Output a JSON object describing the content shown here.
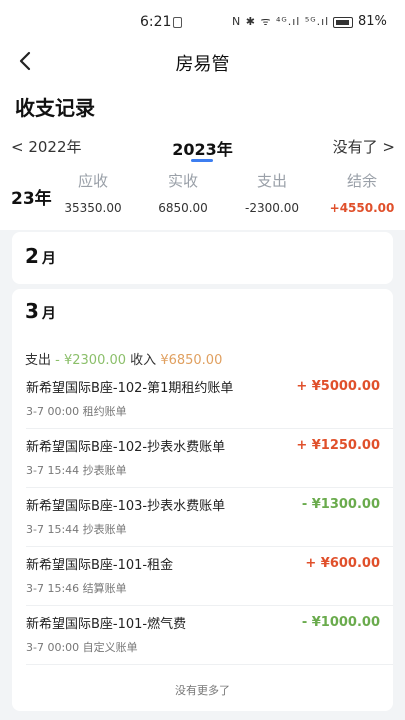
{
  "status_bar": {
    "time": "6:21",
    "icons": "N ✱ ᯤ ⁴ᴳ.ıl ⁵ᴳ.ıl",
    "battery": "81%"
  },
  "navbar": {
    "title": "房易管",
    "back_icon": "chevron-left-icon"
  },
  "header": {
    "title": "收支记录"
  },
  "year_tabs": {
    "prev": "< 2022年",
    "current": "2023年",
    "next": "没有了 >"
  },
  "summary": {
    "year_label": "23年",
    "columns": [
      {
        "label": "应收",
        "value": "35350.00"
      },
      {
        "label": "实收",
        "value": "6850.00"
      },
      {
        "label": "支出",
        "value": "-2300.00"
      },
      {
        "label": "结余",
        "value": "+4550.00"
      }
    ]
  },
  "months": [
    {
      "month": "2",
      "unit": "月"
    },
    {
      "month": "3",
      "unit": "月",
      "stats": {
        "expense_label": "支出",
        "expense": "- ¥2300.00",
        "income_label": "收入",
        "income": "¥6850.00"
      },
      "records": [
        {
          "title": "新希望国际B座-102-第1期租约账单",
          "date": "3-7 00:00",
          "type": "租约账单",
          "amount": "+ ¥5000.00",
          "direction": "in"
        },
        {
          "title": "新希望国际B座-102-抄表水费账单",
          "date": "3-7 15:44",
          "type": "抄表账单",
          "amount": "+ ¥1250.00",
          "direction": "in"
        },
        {
          "title": "新希望国际B座-103-抄表水费账单",
          "date": "3-7 15:44",
          "type": "抄表账单",
          "amount": "- ¥1300.00",
          "direction": "out"
        },
        {
          "title": "新希望国际B座-101-租金",
          "date": "3-7 15:46",
          "type": "结算账单",
          "amount": "+ ¥600.00",
          "direction": "in"
        },
        {
          "title": "新希望国际B座-101-燃气费",
          "date": "3-7 00:00",
          "type": "自定义账单",
          "amount": "- ¥1000.00",
          "direction": "out"
        }
      ],
      "footer": "没有更多了"
    }
  ],
  "colors": {
    "accent": "#3d7ef0",
    "income_red": "#e0502b",
    "expense_green": "#6aab4d"
  }
}
